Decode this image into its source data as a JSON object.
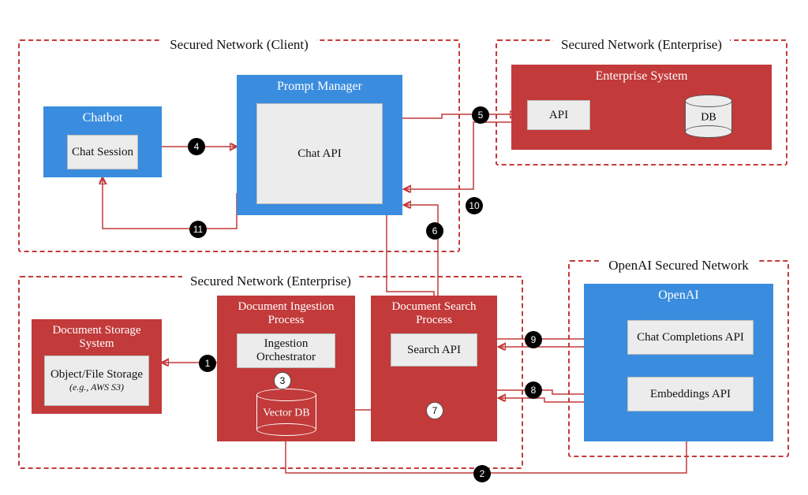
{
  "groups": {
    "client": "Secured Network (Client)",
    "enterprise_top": "Secured Network (Enterprise)",
    "enterprise_mid": "Secured Network (Enterprise)",
    "openai": "OpenAI Secured Network"
  },
  "boxes": {
    "chatbot": {
      "title": "Chatbot",
      "inner": "Chat Session"
    },
    "prompt_manager": {
      "title": "Prompt Manager",
      "inner": "Chat API"
    },
    "enterprise_system": {
      "title": "Enterprise System",
      "api": "API",
      "db": "DB"
    },
    "doc_storage": {
      "title": "Document Storage System",
      "inner": "Object/File Storage",
      "sub": "(e.g., AWS S3)"
    },
    "ingestion": {
      "title": "Document Ingestion Process",
      "inner": "Ingestion Orchestrator",
      "db": "Vector DB"
    },
    "search": {
      "title": "Document Search Process",
      "inner": "Search API"
    },
    "openai_box": {
      "title": "OpenAI",
      "chat": "Chat Completions API",
      "embed": "Embeddings API"
    }
  },
  "steps": {
    "s1": "1",
    "s2": "2",
    "s3": "3",
    "s4": "4",
    "s5": "5",
    "s6": "6",
    "s7": "7",
    "s8": "8",
    "s9": "9",
    "s10": "10",
    "s11": "11"
  },
  "colors": {
    "blue": "#3a8dde",
    "red": "#c23a3a",
    "inner": "#ececec"
  }
}
